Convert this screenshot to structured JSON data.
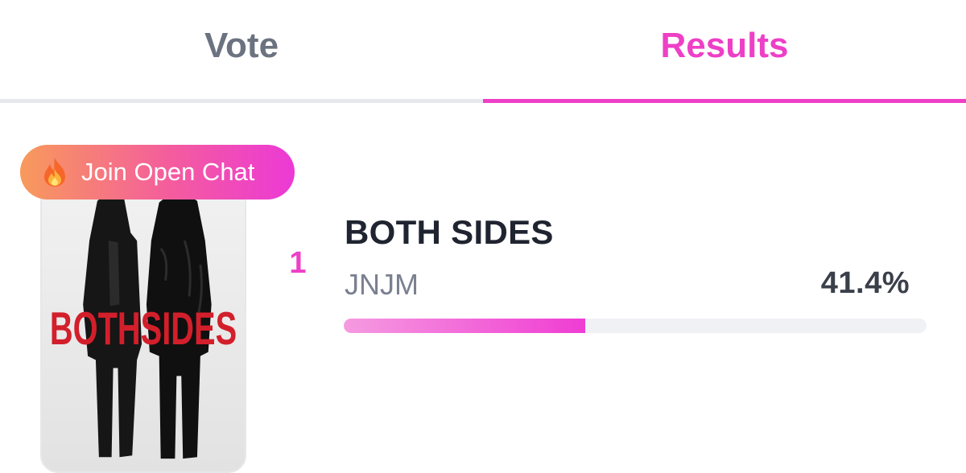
{
  "tabs": [
    {
      "label": "Vote",
      "active": false
    },
    {
      "label": "Results",
      "active": true
    }
  ],
  "colors": {
    "accent": "#ee3fc7",
    "inactive_tab": "#6b7280",
    "badge_gradient_start": "#f89a5b",
    "badge_gradient_end": "#ec39d6",
    "progress_track": "#eff1f5"
  },
  "open_chat": {
    "icon": "fire-icon",
    "label": "Join Open Chat"
  },
  "result": {
    "rank": "1",
    "title": "BOTH SIDES",
    "artist": "JNJM",
    "percent_label": "41.4%",
    "vote_share": 0.414,
    "cover_text": "BOTHSIDES"
  }
}
